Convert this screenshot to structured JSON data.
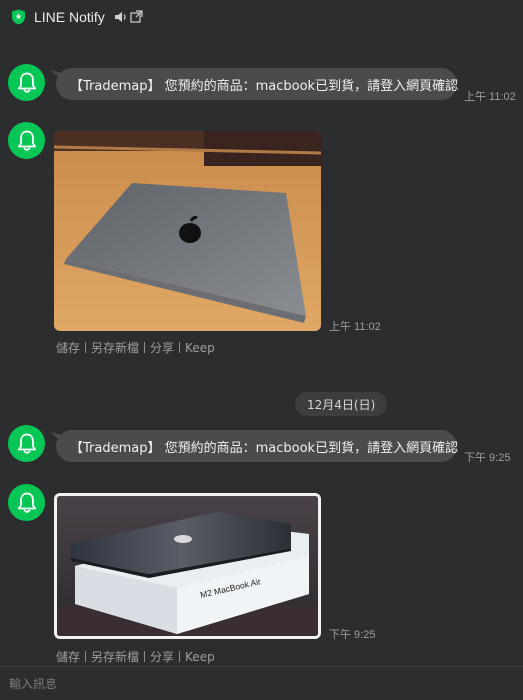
{
  "header": {
    "title": "LINE Notify",
    "shield_icon": "shield-star-icon",
    "sound_icon": "speaker-icon",
    "popout_icon": "external-window-icon",
    "brand_color": "#06c755"
  },
  "messages": [
    {
      "type": "text",
      "text": "【Trademap】 您預約的商品：macbook已到貨，請登入網頁確認",
      "time": "上午 11:02"
    },
    {
      "type": "image",
      "image_desc": "space gray laptop on wooden desk",
      "time": "上午 11:02",
      "actions": [
        "儲存",
        "另存新檔",
        "分享",
        "Keep"
      ]
    },
    {
      "type": "date",
      "label": "12月4日(日)"
    },
    {
      "type": "text",
      "text": "【Trademap】 您預約的商品：macbook已到貨，請登入網頁確認",
      "time": "下午 9:25"
    },
    {
      "type": "image",
      "image_desc": "laptop on top of its retail box",
      "box_text": "M2 MacBook Air",
      "time": "下午 9:25",
      "actions": [
        "儲存",
        "另存新檔",
        "分享",
        "Keep"
      ]
    }
  ],
  "composer": {
    "placeholder": "輸入訊息"
  }
}
